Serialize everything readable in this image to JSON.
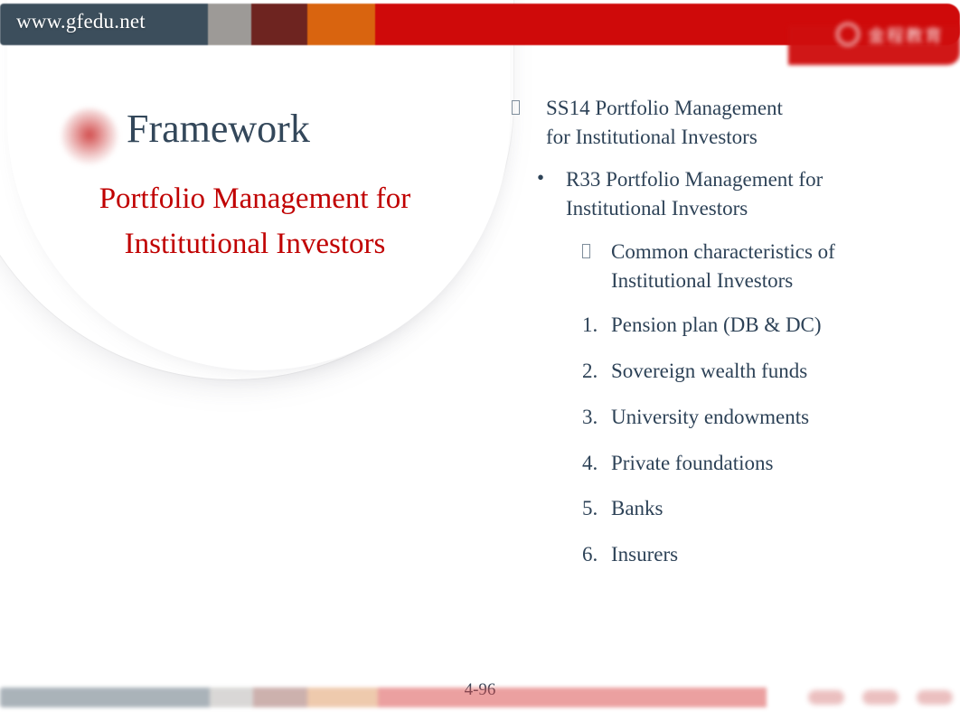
{
  "header": {
    "site_url": "www.gfedu.net",
    "logo_text": "金程教育",
    "logo_icon": "circle-logo-mark"
  },
  "title": {
    "heading": "Framework",
    "subtitle_line1": "Portfolio Management for",
    "subtitle_line2": "Institutional   Investors",
    "heading_color": "#33475a",
    "subtitle_color": "#c00000",
    "dot_icon": "red-dot-accent"
  },
  "outline": {
    "level1": {
      "marker": "tofu-box",
      "line1": "SS14 Portfolio Management",
      "line2": "for Institutional Investors"
    },
    "level2": {
      "marker": "•",
      "line1": "R33 Portfolio Management for",
      "line2": "Institutional Investors"
    },
    "level3": {
      "marker": "tofu-box",
      "line1": "Common characteristics of",
      "line2": "Institutional Investors"
    },
    "numbered": [
      {
        "marker": "1.",
        "label": "Pension plan (DB & DC)"
      },
      {
        "marker": "2.",
        "label": "Sovereign wealth funds"
      },
      {
        "marker": "3.",
        "label": "University endowments"
      },
      {
        "marker": "4.",
        "label": "Private foundations"
      },
      {
        "marker": "5.",
        "label": "Banks"
      },
      {
        "marker": "6.",
        "label": "Insurers"
      }
    ]
  },
  "footer": {
    "page_number": "4-96"
  },
  "colors": {
    "header_slate": "#3c4e5c",
    "header_gray": "#9d9a97",
    "header_maroon": "#6e2420",
    "header_orange": "#d9640f",
    "header_red": "#cf0a0a",
    "body_text": "#2d4257",
    "accent_red": "#c00000"
  }
}
